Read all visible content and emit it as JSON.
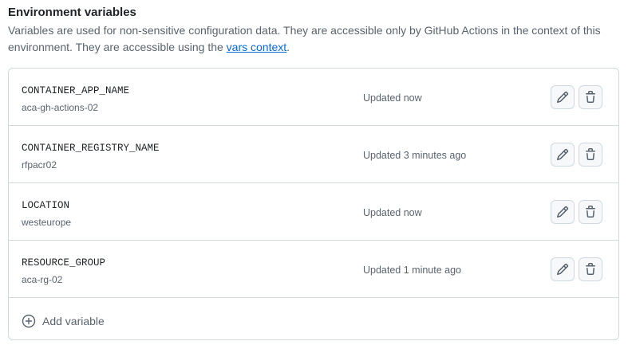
{
  "section": {
    "title": "Environment variables",
    "description_prefix": "Variables are used for non-sensitive configuration data. They are accessible only by GitHub Actions in the context of this environment. They are accessible using the ",
    "link_text": "vars context",
    "description_suffix": "."
  },
  "variables": [
    {
      "name": "CONTAINER_APP_NAME",
      "value": "aca-gh-actions-02",
      "updated": "Updated now"
    },
    {
      "name": "CONTAINER_REGISTRY_NAME",
      "value": "rfpacr02",
      "updated": "Updated 3 minutes ago"
    },
    {
      "name": "LOCATION",
      "value": "westeurope",
      "updated": "Updated now"
    },
    {
      "name": "RESOURCE_GROUP",
      "value": "aca-rg-02",
      "updated": "Updated 1 minute ago"
    }
  ],
  "add_button": {
    "label": "Add variable",
    "icon": "plus-circle-icon"
  },
  "icons": {
    "edit": "pencil-icon",
    "delete": "trash-icon"
  },
  "colors": {
    "link": "#0969da",
    "muted": "#59636e",
    "border": "#d1d9e0"
  }
}
